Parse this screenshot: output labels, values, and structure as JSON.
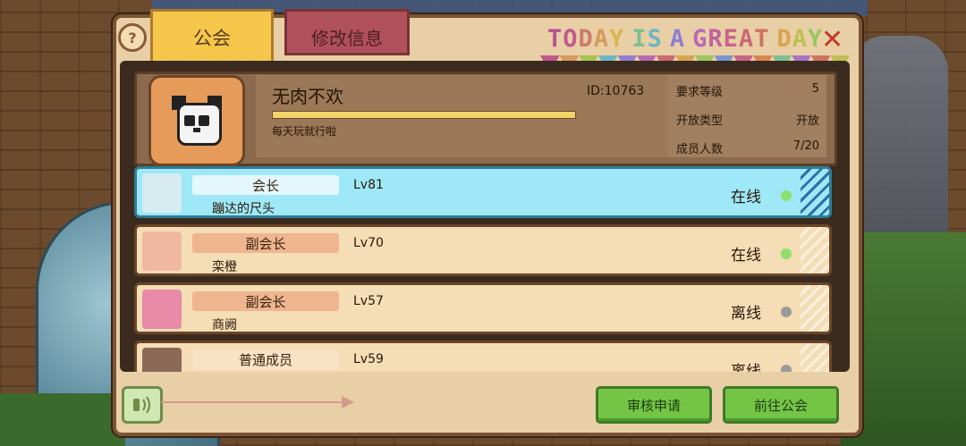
{
  "tabs": [
    {
      "label": "公会"
    },
    {
      "label": "修改信息"
    }
  ],
  "banner_title": "TODAY IS A GREAT DAY",
  "guild": {
    "name": "无肉不欢",
    "id": "ID:10763",
    "motto": "每天玩就行啦",
    "stats": [
      {
        "label": "要求等级",
        "value": "5"
      },
      {
        "label": "开放类型",
        "value": "开放"
      },
      {
        "label": "成员人数",
        "value": "7/20"
      }
    ]
  },
  "members": [
    {
      "role": "会长",
      "name": "蹦达的尺头",
      "level": "Lv81",
      "status": "在线",
      "online": true,
      "role_color": "#e4f7fb"
    },
    {
      "role": "副会长",
      "name": "栾橙",
      "level": "Lv70",
      "status": "在线",
      "online": true,
      "role_color": "#efb58f"
    },
    {
      "role": "副会长",
      "name": "商阙",
      "level": "Lv57",
      "status": "离线",
      "online": false,
      "role_color": "#efb58f"
    },
    {
      "role": "普通成员",
      "name": "",
      "level": "Lv59",
      "status": "离线",
      "online": false,
      "role_color": "#f8e3c6"
    }
  ],
  "buttons": {
    "review": "审核申请",
    "goto": "前往公会"
  },
  "icons": {
    "help": "question-icon",
    "close": "close-icon",
    "voice": "voice-icon"
  }
}
